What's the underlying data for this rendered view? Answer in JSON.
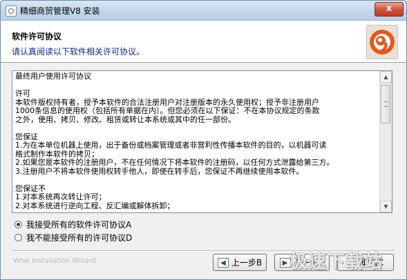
{
  "window": {
    "title": "精细商贸管理V8 安装",
    "close_label": "x"
  },
  "header": {
    "title": "软件许可协议",
    "subtitle": "请认真阅读以下软件相关许可协议。"
  },
  "license": {
    "text": "最终用户使用许可协议\n\n许可\n本软件版权持有者，授予本软件的合法注册用户对注册版本的永久使用权；授予非注册用户\n1000条信息的使用权（包括所有单据在内）。但您必须在以下保证：不在本协议规定的条款\n之外，使用、拷贝、修改、租赁或转让本系统或其中的任一部份。\n\n您保证\n1.为在本单位机器上使用，出于备份或档案管理或者非营利性传播本软件的目的，以机器可读\n格式制作本软件的拷贝；\n2.如果您是本软件的注册用户，不在任何情况下将本软件的注册码，以任何方式泄露给第三方。\n3.注册用户不将本软件使用权转手他人，即使在转手后，您保证不再继续使用本软件。\n\n您保证不\n1.对本系统再次转让许可；\n2.对本系统进行逆向工程、反汇编或解体拆卸；"
  },
  "options": [
    {
      "label": "我接受所有的软件许可协议A",
      "selected": true
    },
    {
      "label": "我不能接受所有的许可协议D",
      "selected": false
    }
  ],
  "buttons": {
    "back": "上一步B",
    "next": "下一步N",
    "cancel": "取消C"
  },
  "watermarks": {
    "left": "Wise Installation Wizard",
    "right": "极速下载站"
  },
  "colors": {
    "title_bar": "#c4d7ec",
    "close_button": "#d4553e",
    "subtitle_text": "#0a2a78",
    "logo_orange": "#e8571c"
  }
}
